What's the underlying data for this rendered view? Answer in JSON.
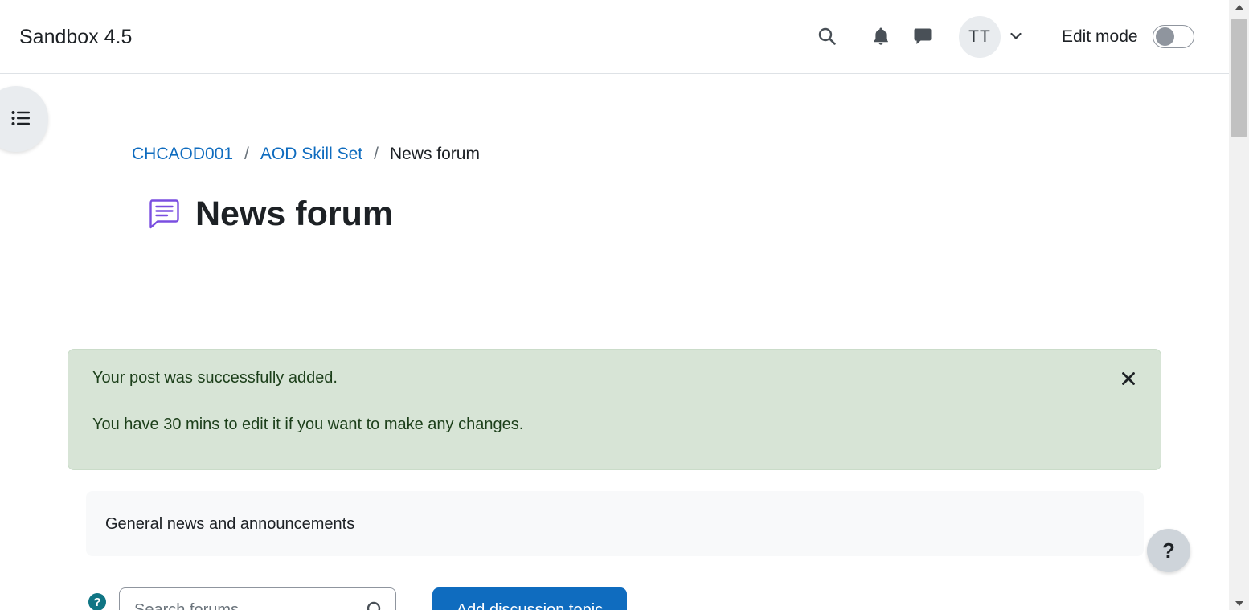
{
  "header": {
    "site_name": "Sandbox 4.5",
    "user_initials": "TT",
    "edit_mode_label": "Edit mode",
    "edit_mode_on": false,
    "icons": {
      "search": "search-icon",
      "notifications": "bell-icon",
      "messages": "chat-bubble-icon",
      "user_menu": "chevron-down-icon"
    }
  },
  "drawer": {
    "icon": "list-icon"
  },
  "breadcrumb": [
    {
      "label": "CHCAOD001",
      "link": true
    },
    {
      "label": "AOD Skill Set",
      "link": true
    },
    {
      "label": "News forum",
      "link": false
    }
  ],
  "breadcrumb_separator": "/",
  "page": {
    "title": "News forum",
    "title_icon": "forum-icon"
  },
  "alert": {
    "line1": "Your post was successfully added.",
    "line2": "You have 30 mins to edit it if you want to make any changes.",
    "close_icon": "close-icon"
  },
  "intro": {
    "text": "General news and announcements"
  },
  "help_float": {
    "label": "?"
  },
  "search": {
    "help_label": "?",
    "placeholder": "Search forums"
  },
  "actions": {
    "add_discussion_label": "Add discussion topic"
  },
  "colors": {
    "link": "#0f6cbf",
    "primary_button": "#0f6cbf",
    "alert_bg": "#d7e4d6",
    "alert_text": "#1c3f1a",
    "forum_icon": "#7a4ee0",
    "help_icon_bg": "#0f7584"
  }
}
